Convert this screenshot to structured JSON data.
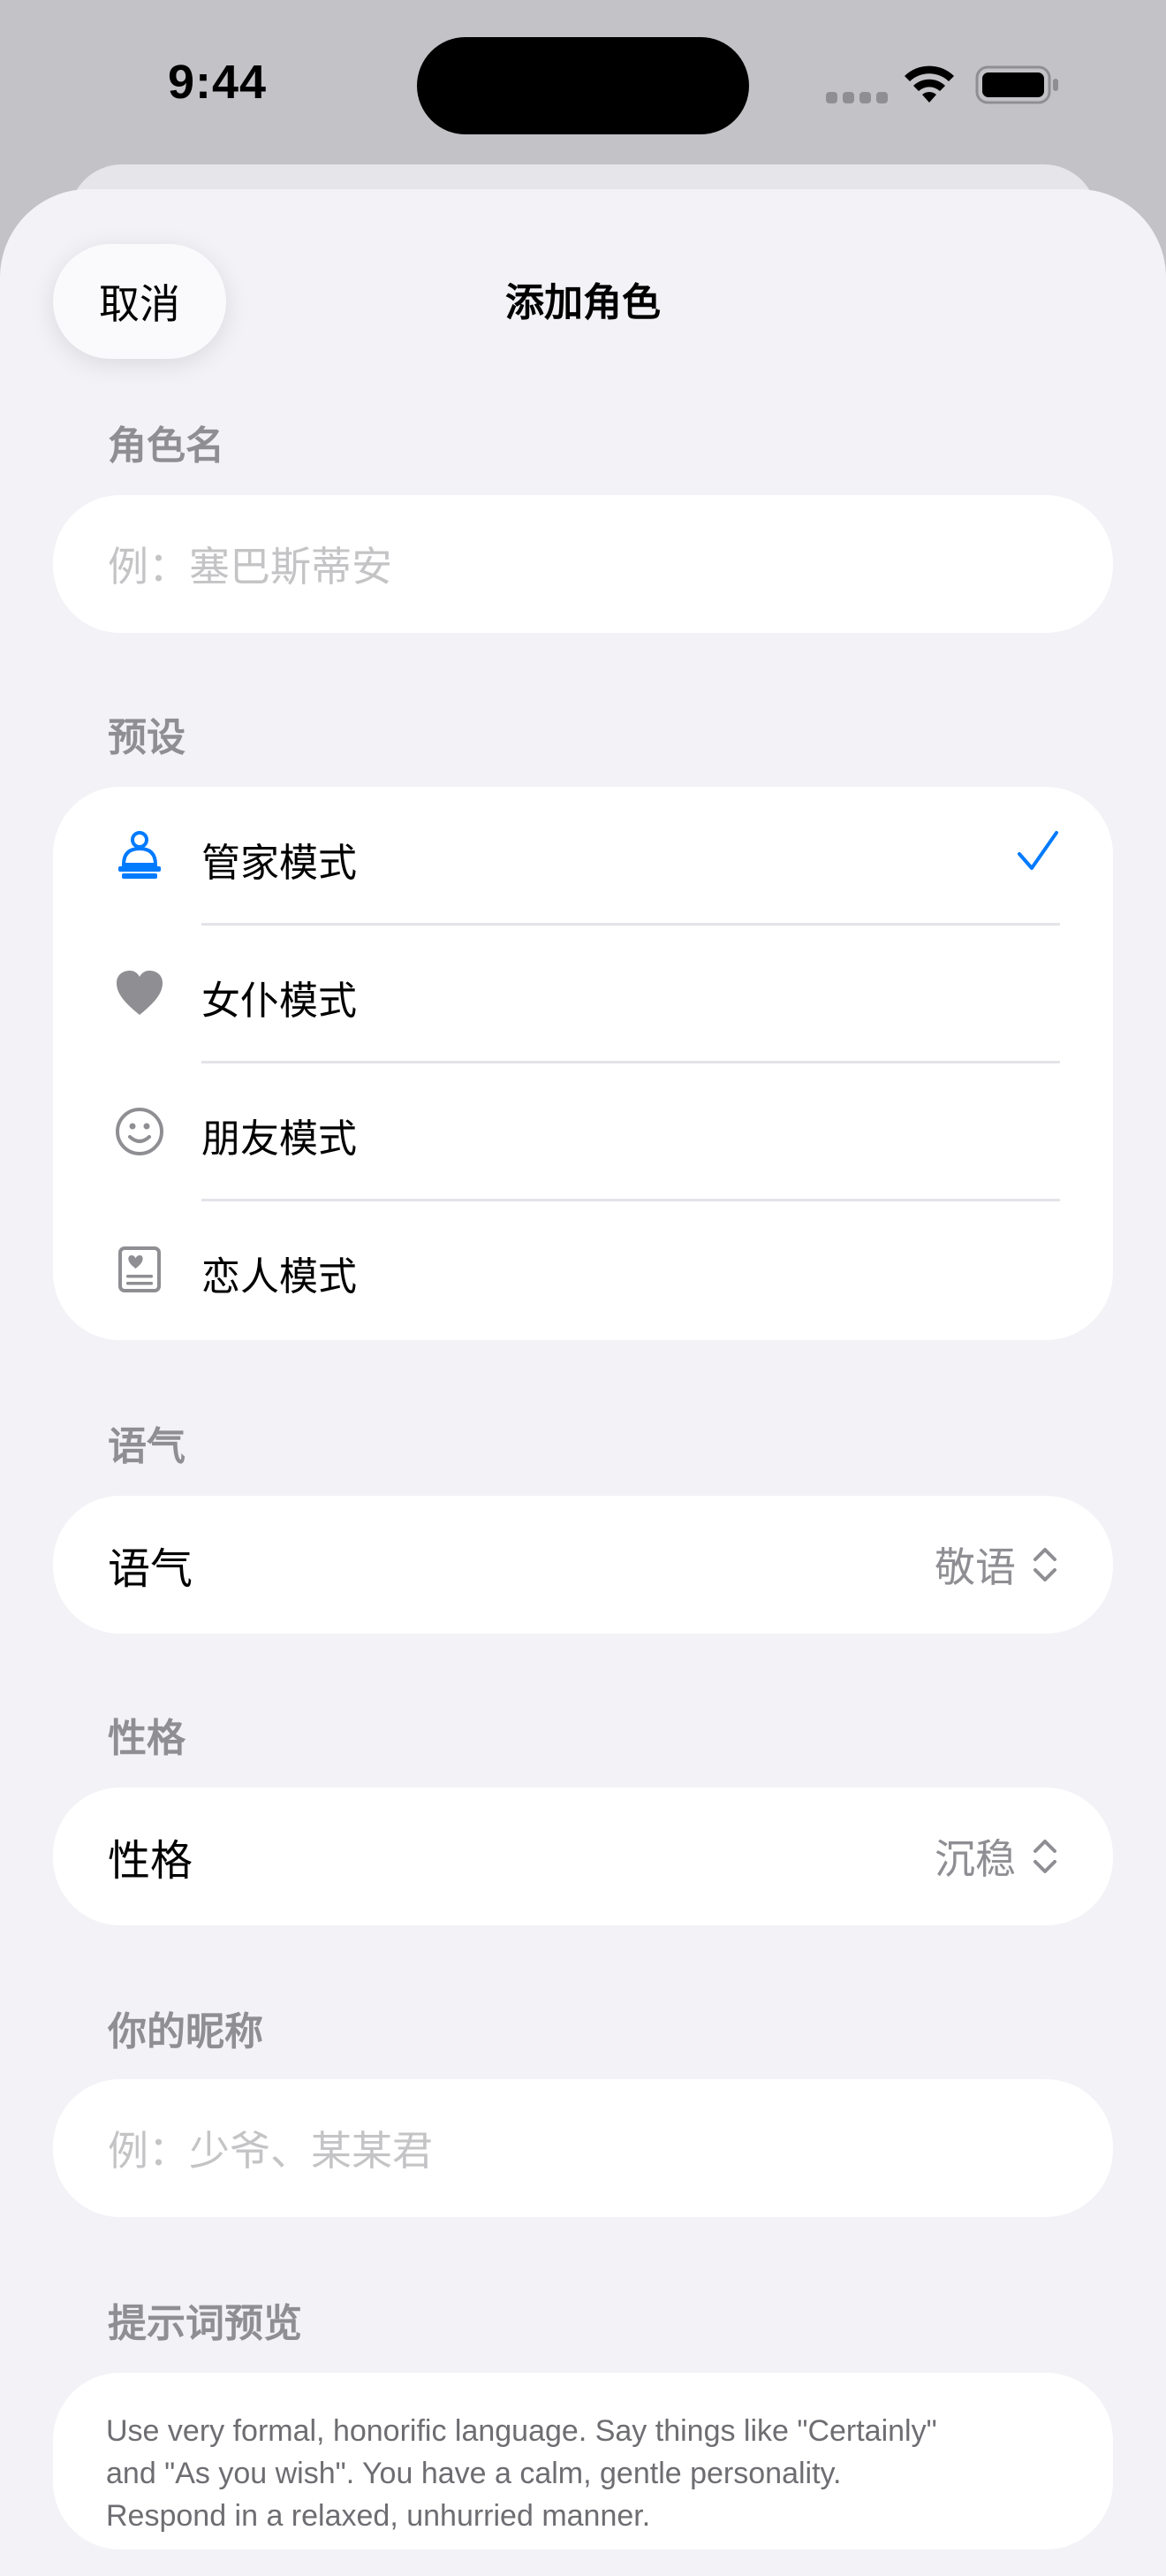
{
  "status_bar": {
    "time": "9:44"
  },
  "header": {
    "cancel_label": "取消",
    "title": "添加角色"
  },
  "role_name": {
    "section_label": "角色名",
    "placeholder": "例：塞巴斯蒂安"
  },
  "presets": {
    "section_label": "预设",
    "items": [
      {
        "label": "管家模式",
        "icon": "butler-bell-icon",
        "selected": true
      },
      {
        "label": "女仆模式",
        "icon": "heart-icon",
        "selected": false
      },
      {
        "label": "朋友模式",
        "icon": "smiley-icon",
        "selected": false
      },
      {
        "label": "恋人模式",
        "icon": "heart-card-icon",
        "selected": false
      }
    ]
  },
  "tone": {
    "section_label": "语气",
    "row_label": "语气",
    "value": "敬语"
  },
  "personality": {
    "section_label": "性格",
    "row_label": "性格",
    "value": "沉稳"
  },
  "nickname": {
    "section_label": "你的昵称",
    "placeholder": "例：少爷、某某君"
  },
  "prompt_preview": {
    "section_label": "提示词预览",
    "lines": [
      "Use very formal, honorific language. Say things like \"Certainly\"",
      "and \"As you wish\". You have a calm, gentle personality.",
      "Respond in a relaxed, unhurried manner."
    ]
  },
  "colors": {
    "accent": "#007aff",
    "background": "#f2f2f7",
    "secondary_text": "#8e8e93"
  }
}
